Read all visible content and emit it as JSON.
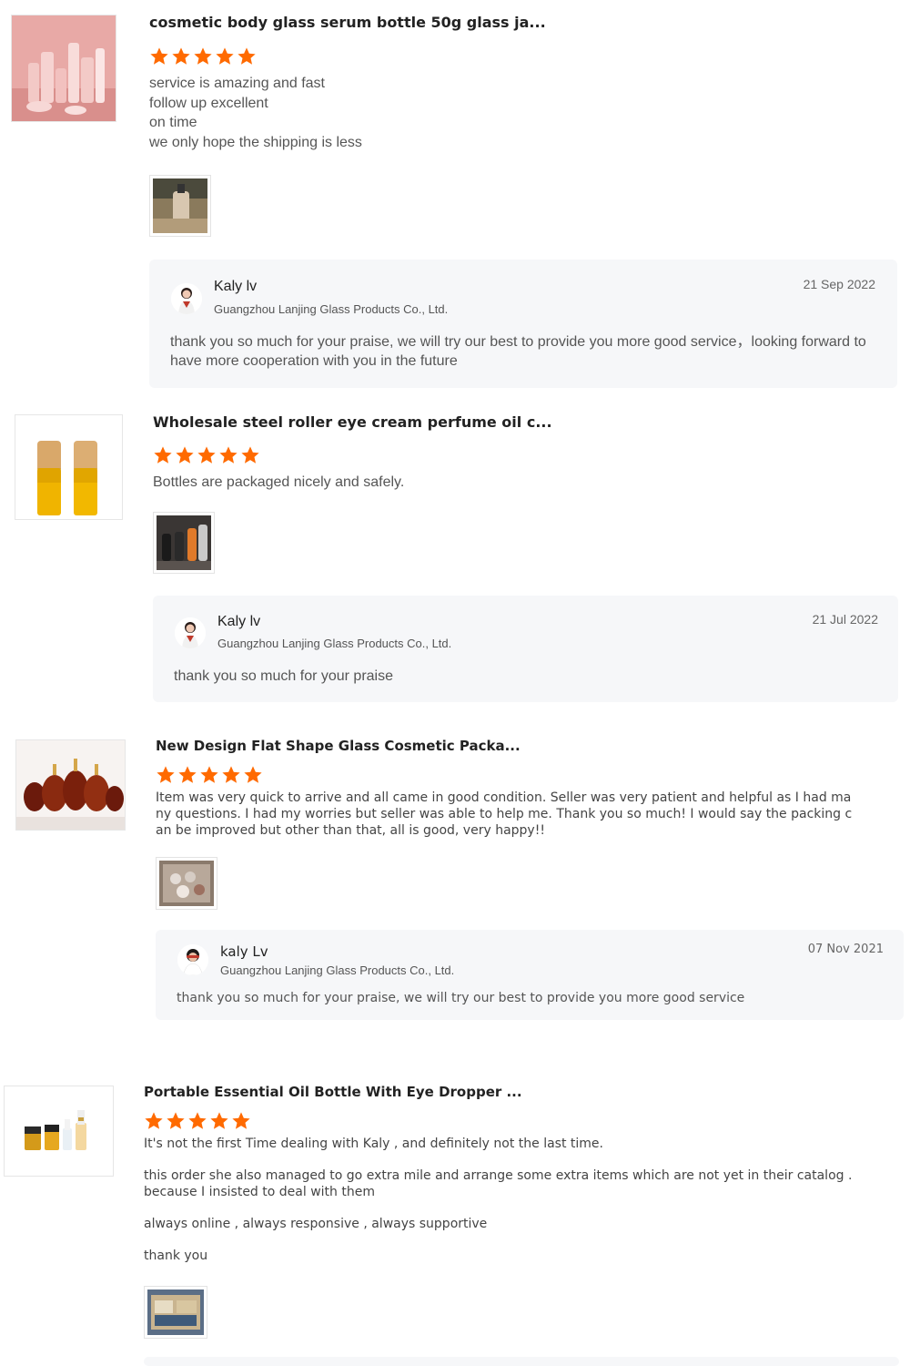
{
  "accent": "#ff6a00",
  "reviews": [
    {
      "title": "cosmetic body glass serum bottle 50g glass ja...",
      "rating": 5,
      "text": "service is amazing and fast\nfollow up excellent\non time\nwe only hope the shipping is less",
      "product_image": "pink-cosmetic-bottles-set",
      "photo": "bottle-photo",
      "reply": {
        "name": "Kaly lv",
        "company": "Guangzhou Lanjing Glass Products Co., Ltd.",
        "date": "21 Sep 2022",
        "text": "thank you so much for your praise, we will try our best to provide you more good service，looking forward to have more cooperation with you in the future"
      }
    },
    {
      "title": "Wholesale steel roller eye cream perfume oil c...",
      "rating": 5,
      "text": "Bottles are packaged nicely and safely.",
      "product_image": "amber-roller-bottles",
      "photo": "packaged-bottles-photo",
      "reply": {
        "name": "Kaly lv",
        "company": "Guangzhou Lanjing Glass Products Co., Ltd.",
        "date": "21 Jul 2022",
        "text": "thank you so much for your praise"
      }
    },
    {
      "title": "New Design Flat Shape Glass Cosmetic Packa...",
      "rating": 5,
      "text": "Item was very quick to arrive and all came in good condition. Seller was very patient and helpful as I had many questions. I had my worries but seller was able to help me. Thank you so much! I would say the packing can be improved but other than that, all is good, very happy!!",
      "product_image": "amber-flat-bottles",
      "photo": "box-of-bottles-photo",
      "reply": {
        "name": "kaly Lv",
        "company": "Guangzhou Lanjing Glass Products Co., Ltd.",
        "date": "07 Nov 2021",
        "text": "thank you so much for your praise, we will try our best to provide you more good service"
      }
    },
    {
      "title": "Portable Essential Oil Bottle With Eye Dropper ...",
      "rating": 5,
      "paragraphs": [
        "It's not the first Time dealing with Kaly  , and definitely not the last time.",
        "this order she also managed to go extra mile and arrange some extra items which are not yet in their catalog . because I insisted to deal with them",
        "always online , always responsive , always supportive",
        "thank you"
      ],
      "product_image": "small-dropper-bottles",
      "photo": "shipment-box-photo"
    }
  ]
}
